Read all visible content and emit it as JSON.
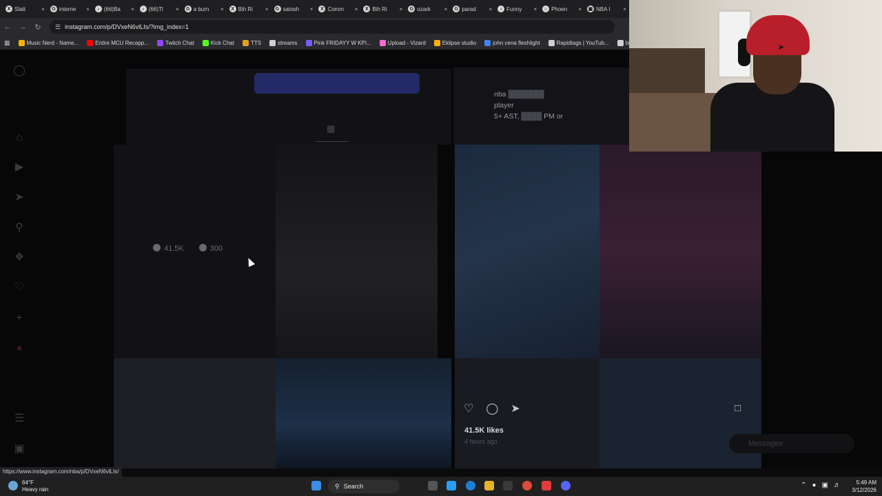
{
  "tabs": [
    {
      "label": "Slatt",
      "icon": "x-icon"
    },
    {
      "label": "interne",
      "icon": "chrome-icon"
    },
    {
      "label": "(66)Ba",
      "icon": "tiktok-icon"
    },
    {
      "label": "(66)Tl",
      "icon": "tiktok-icon"
    },
    {
      "label": "a burn",
      "icon": "chrome-icon"
    },
    {
      "label": "Bih Ri",
      "icon": "x-icon"
    },
    {
      "label": "satosh",
      "icon": "chrome-icon"
    },
    {
      "label": "Comm",
      "icon": "x-icon"
    },
    {
      "label": "Bih Ri",
      "icon": "x-icon"
    },
    {
      "label": "ozark",
      "icon": "chrome-icon"
    },
    {
      "label": "parad",
      "icon": "chrome-icon"
    },
    {
      "label": "Funny",
      "icon": "tiktok-icon"
    },
    {
      "label": "Phoen",
      "icon": "generic-icon"
    },
    {
      "label": "NBA I",
      "icon": "instagram-icon"
    }
  ],
  "address": {
    "url": "instagram.com/p/DVxeN6vlLIs/?img_index=1"
  },
  "bookmarks": [
    {
      "label": "Music Nerd - Name...",
      "color": "#f4b400"
    },
    {
      "label": "Entire MCU Recapp...",
      "color": "#ff0000"
    },
    {
      "label": "Twitch Chat",
      "color": "#9146ff"
    },
    {
      "label": "Kick Chat",
      "color": "#53fc18"
    },
    {
      "label": "TTS",
      "color": "#e0a020"
    },
    {
      "label": "streams",
      "color": "#cfcfcf"
    },
    {
      "label": "Pink FRIDAYY W KPI...",
      "color": "#7b5cff"
    },
    {
      "label": "Upload - Vizard",
      "color": "#ff6ad5"
    },
    {
      "label": "Eklipse studio",
      "color": "#ffb300"
    },
    {
      "label": "john cena fleshlight",
      "color": "#4285f4"
    },
    {
      "label": "Rapidtags | YouTub...",
      "color": "#cfcfcf"
    },
    {
      "label": "bih links",
      "color": "#cfcfcf"
    }
  ],
  "profile": {
    "hover_likes": "41.5K",
    "hover_comments": "300"
  },
  "post": {
    "caption_line1": "nba",
    "caption_line2": "player",
    "caption_line3": "5+ AST,",
    "caption_line3b": "PM or",
    "likes": "41.5K likes",
    "time": "4 hours ago"
  },
  "messages": {
    "label": "Messages"
  },
  "statusbar": {
    "url": "https://www.instagram.com/nba/p/DVxeN6vlLIs/"
  },
  "taskbar": {
    "temp": "64°F",
    "weather": "Heavy rain",
    "search_label": "Search",
    "time": "5:49 AM",
    "date": "3/12/2026"
  }
}
